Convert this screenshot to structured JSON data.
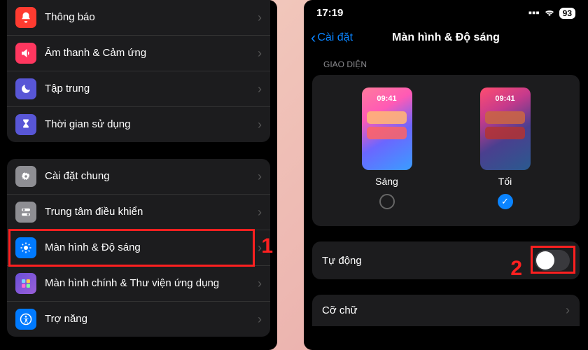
{
  "left": {
    "group1": [
      {
        "label": "Thông báo",
        "icon": "bell-icon",
        "color": "#ff3b30"
      },
      {
        "label": "Âm thanh & Cảm ứng",
        "icon": "speaker-icon",
        "color": "#ff375f"
      },
      {
        "label": "Tập trung",
        "icon": "moon-icon",
        "color": "#5856d6"
      },
      {
        "label": "Thời gian sử dụng",
        "icon": "hourglass-icon",
        "color": "#5856d6"
      }
    ],
    "group2": [
      {
        "label": "Cài đặt chung",
        "icon": "gear-icon",
        "color": "#8e8e93"
      },
      {
        "label": "Trung tâm điều khiển",
        "icon": "switches-icon",
        "color": "#8e8e93"
      },
      {
        "label": "Màn hình & Độ sáng",
        "icon": "brightness-icon",
        "color": "#007aff",
        "highlighted": true,
        "annotation": "1"
      },
      {
        "label": "Màn hình chính & Thư viện ứng dụng",
        "icon": "grid-icon",
        "color": "#4f3a9d"
      },
      {
        "label": "Trợ năng",
        "icon": "accessibility-icon",
        "color": "#007aff"
      }
    ]
  },
  "right": {
    "status": {
      "time": "17:19",
      "battery": "93"
    },
    "nav": {
      "back": "Cài đặt",
      "title": "Màn hình & Độ sáng"
    },
    "section_appearance": "GIAO DIỆN",
    "appearance": {
      "preview_time": "09:41",
      "light_label": "Sáng",
      "dark_label": "Tối",
      "selected": "dark"
    },
    "auto": {
      "label": "Tự động",
      "on": false,
      "annotation": "2"
    },
    "text_size_label": "Cỡ chữ"
  }
}
